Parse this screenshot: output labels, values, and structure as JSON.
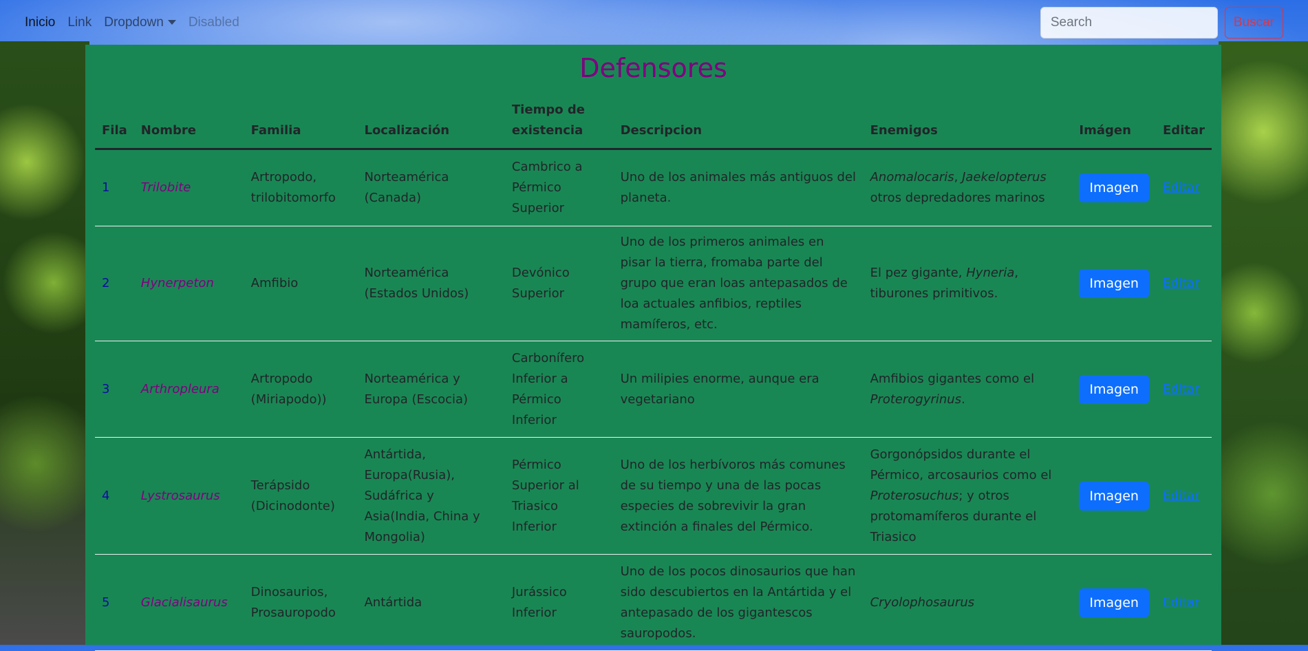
{
  "nav": {
    "items": [
      "Inicio",
      "Link",
      "Dropdown",
      "Disabled"
    ],
    "search_placeholder": "Search",
    "search_button": "Buscar"
  },
  "page_title": "Defensores",
  "table": {
    "headers": [
      "Fila",
      "Nombre",
      "Familia",
      "Localización",
      "Tiempo de existencia",
      "Descripcion",
      "Enemigos",
      "Imágen",
      "Editar"
    ],
    "rows": [
      {
        "fila": "1",
        "nombre": "Trilobite",
        "familia": "Artropodo, trilobitomorfo",
        "localizacion": "Norteamérica (Canada)",
        "tiempo": "Cambrico a Pérmico Superior",
        "descripcion": "Uno de los animales más antiguos del planeta.",
        "enemigos_pre": "",
        "enemigos_italic": "Anomalocaris",
        "enemigos_mid": ", ",
        "enemigos_italic2": "Jaekelopterus",
        "enemigos_post": " otros depredadores marinos",
        "imagen": "Imagen",
        "editar": "Editar"
      },
      {
        "fila": "2",
        "nombre": "Hynerpeton",
        "familia": "Amfibio",
        "localizacion": "Norteamérica (Estados Unidos)",
        "tiempo": "Devónico Superior",
        "descripcion": "Uno de los primeros animales en pisar la tierra, fromaba parte del grupo que eran loas antepasados de loa actuales anfibios, reptiles mamíferos, etc.",
        "enemigos_pre": "El pez gigante, ",
        "enemigos_italic": "Hyneria",
        "enemigos_mid": ",",
        "enemigos_italic2": "",
        "enemigos_post": " tiburones primitivos.",
        "imagen": "Imagen",
        "editar": "Editar"
      },
      {
        "fila": "3",
        "nombre": "Arthropleura",
        "familia": "Artropodo (Miriapodo))",
        "localizacion": "Norteamérica y Europa (Escocia)",
        "tiempo": "Carbonífero Inferior a Pérmico Inferior",
        "descripcion": "Un milipies enorme, aunque era vegetariano",
        "enemigos_pre": "Amfibios gigantes como el ",
        "enemigos_italic": "Proterogyrinus",
        "enemigos_mid": ".",
        "enemigos_italic2": "",
        "enemigos_post": "",
        "imagen": "Imagen",
        "editar": "Editar"
      },
      {
        "fila": "4",
        "nombre": "Lystrosaurus",
        "familia": "Terápsido (Dicinodonte)",
        "localizacion": "Antártida, Europa(Rusia), Sudáfrica y Asia(India, China y Mongolia)",
        "tiempo": "Pérmico Superior al Triasico Inferior",
        "descripcion": "Uno de los herbívoros más comunes de su tiempo y una de las pocas especies de sobrevivir la gran extinción a finales del Pérmico.",
        "enemigos_pre": "Gorgonópsidos durante el Pérmico, arcosaurios como el ",
        "enemigos_italic": "Proterosuchus",
        "enemigos_mid": "; y otros protomamíferos durante el Triasico",
        "enemigos_italic2": "",
        "enemigos_post": "",
        "imagen": "Imagen",
        "editar": "Editar"
      },
      {
        "fila": "5",
        "nombre": "Glacialisaurus",
        "familia": "Dinosaurios, Prosauropodo",
        "localizacion": "Antártida",
        "tiempo": "Jurássico Inferior",
        "descripcion": "Uno de los pocos dinosaurios que han sido descubiertos en la Antártida y el antepasado de los gigantescos sauropodos.",
        "enemigos_pre": "",
        "enemigos_italic": "Cryolophosaurus",
        "enemigos_mid": "",
        "enemigos_italic2": "",
        "enemigos_post": "",
        "imagen": "Imagen",
        "editar": "Editar"
      }
    ]
  },
  "colors": {
    "content_bg": "#198754",
    "title": "#800080",
    "primary": "#0d6efd",
    "danger": "#dc3545"
  }
}
